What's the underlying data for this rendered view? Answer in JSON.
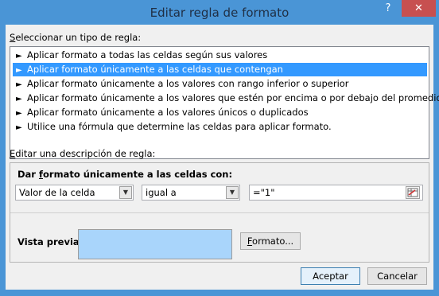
{
  "window": {
    "title": "Editar regla de formato",
    "help_label": "?",
    "close_label": "✕"
  },
  "rule_type": {
    "label_prefix": "S",
    "label_rest": "eleccionar un tipo de regla:",
    "items": [
      {
        "label": "Aplicar formato a todas las celdas según sus valores",
        "selected": false
      },
      {
        "label": "Aplicar formato únicamente a las celdas que contengan",
        "selected": true
      },
      {
        "label": "Aplicar formato únicamente a los valores con rango inferior o superior",
        "selected": false
      },
      {
        "label": "Aplicar formato únicamente a los valores que estén por encima o por debajo del promedio",
        "selected": false
      },
      {
        "label": "Aplicar formato únicamente a los valores únicos o duplicados",
        "selected": false
      },
      {
        "label": "Utilice una fórmula que determine las celdas para aplicar formato.",
        "selected": false
      }
    ],
    "arrow_glyph": "►"
  },
  "description": {
    "label_prefix": "E",
    "label_rest": "ditar una descripción de regla:",
    "header_pre": "Dar ",
    "header_u": "f",
    "header_post": "ormato únicamente a las celdas con:",
    "condition_type": "Valor de la celda",
    "operator": "igual a",
    "value": "=\"1\"",
    "preview_label": "Vista previa:",
    "format_button_u": "F",
    "format_button_rest": "ormato..."
  },
  "footer": {
    "accept_label": "Aceptar",
    "cancel_label": "Cancelar"
  },
  "colors": {
    "title_bar": "#4a95d6",
    "selection": "#3399ff",
    "preview_fill": "#a9d5fb",
    "close_button": "#c75050"
  }
}
